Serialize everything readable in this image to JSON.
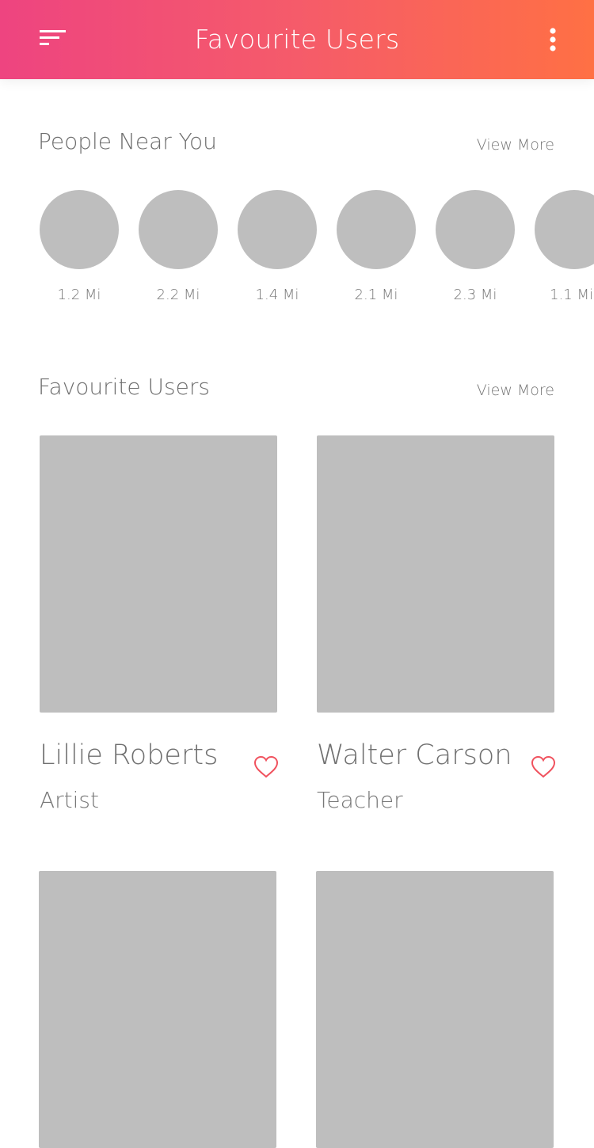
{
  "header": {
    "title": "Favourite Users",
    "menu_icon": "sort-menu-icon",
    "more_icon": "more-vertical-icon"
  },
  "nearby": {
    "title": "People Near You",
    "view_more": "View More",
    "people": [
      {
        "distance": "1.2 Mi"
      },
      {
        "distance": "2.2 Mi"
      },
      {
        "distance": "1.4 Mi"
      },
      {
        "distance": "2.1 Mi"
      },
      {
        "distance": "2.3 Mi"
      },
      {
        "distance": "1.1 Mi"
      }
    ]
  },
  "favourites": {
    "title": "Favourite Users",
    "view_more": "View More",
    "users": [
      {
        "name": "Lillie Roberts",
        "role": "Artist"
      },
      {
        "name": "Walter Carson",
        "role": "Teacher"
      }
    ]
  },
  "colors": {
    "gradient_start": "#ee4480",
    "gradient_end": "#ff7044",
    "placeholder": "#bebebe",
    "heart": "#f0525e"
  }
}
